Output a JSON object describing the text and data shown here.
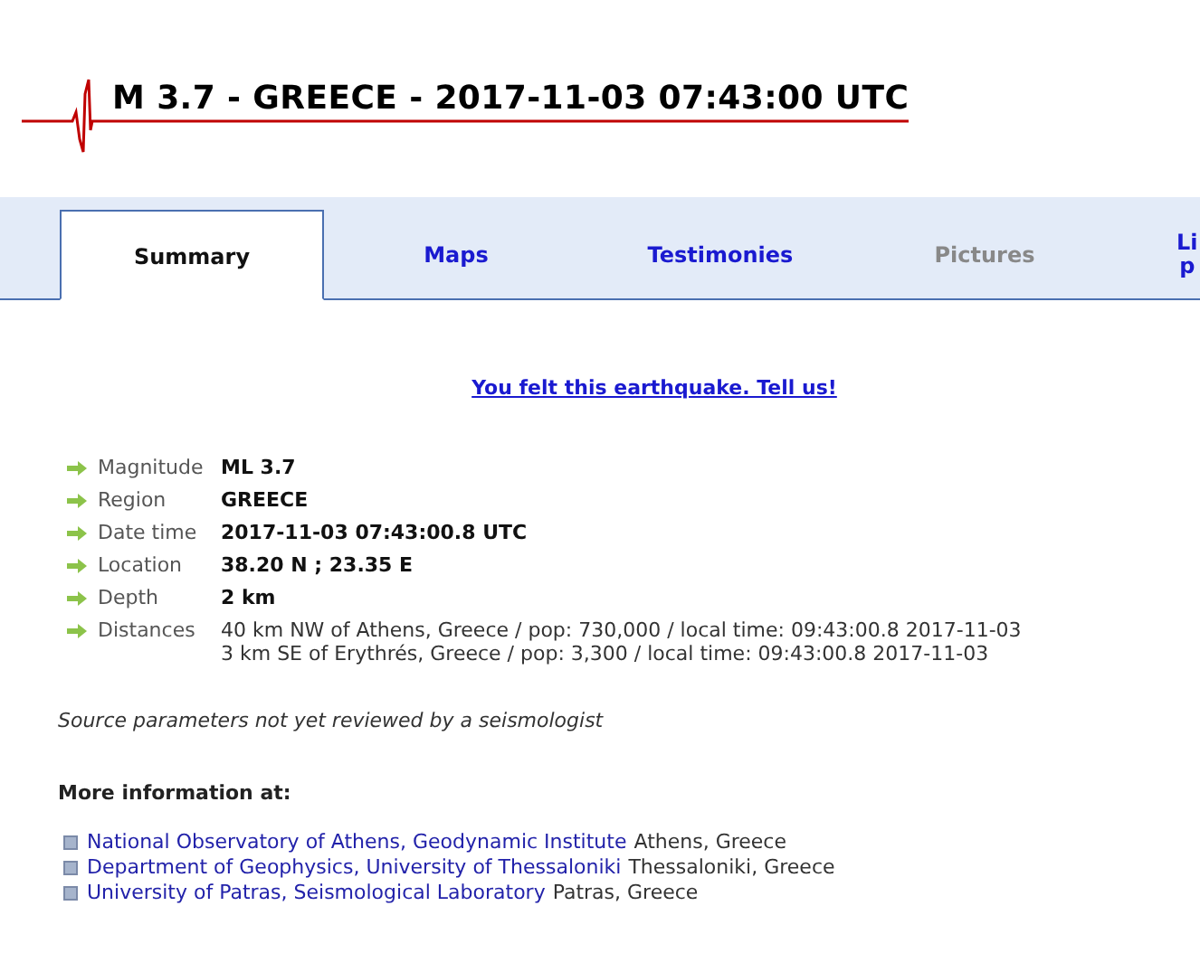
{
  "title": "M 3.7 - GREECE - 2017-11-03 07:43:00 UTC",
  "tabs": [
    {
      "label": "Summary",
      "selected": true,
      "disabled": false
    },
    {
      "label": "Maps",
      "selected": false,
      "disabled": false
    },
    {
      "label": "Testimonies",
      "selected": false,
      "disabled": false
    },
    {
      "label": "Pictures",
      "selected": false,
      "disabled": true
    },
    {
      "label": "Li\np",
      "selected": false,
      "disabled": false
    }
  ],
  "felt_link": "You felt this earthquake. Tell us!",
  "details": [
    {
      "label": "Magnitude",
      "values": [
        "ML 3.7"
      ],
      "bold": true
    },
    {
      "label": "Region",
      "values": [
        "GREECE"
      ],
      "bold": true
    },
    {
      "label": "Date time",
      "values": [
        "2017-11-03 07:43:00.8 UTC"
      ],
      "bold": true
    },
    {
      "label": "Location",
      "values": [
        "38.20 N ; 23.35 E"
      ],
      "bold": true
    },
    {
      "label": "Depth",
      "values": [
        "2 km"
      ],
      "bold": true
    },
    {
      "label": "Distances",
      "values": [
        "40 km NW of Athens, Greece / pop: 730,000 / local time: 09:43:00.8 2017-11-03",
        "3 km SE of Erythrés, Greece / pop: 3,300 / local time: 09:43:00.8 2017-11-03"
      ],
      "bold": false
    }
  ],
  "note": "Source parameters not yet reviewed by a seismologist",
  "more_info": {
    "heading": "More information at:",
    "links": [
      {
        "name": "National Observatory of Athens, Geodynamic Institute",
        "place": "Athens, Greece"
      },
      {
        "name": "Department of Geophysics, University of Thessaloniki",
        "place": "Thessaloniki, Greece"
      },
      {
        "name": "University of Patras, Seismological Laboratory",
        "place": "Patras, Greece"
      }
    ]
  }
}
